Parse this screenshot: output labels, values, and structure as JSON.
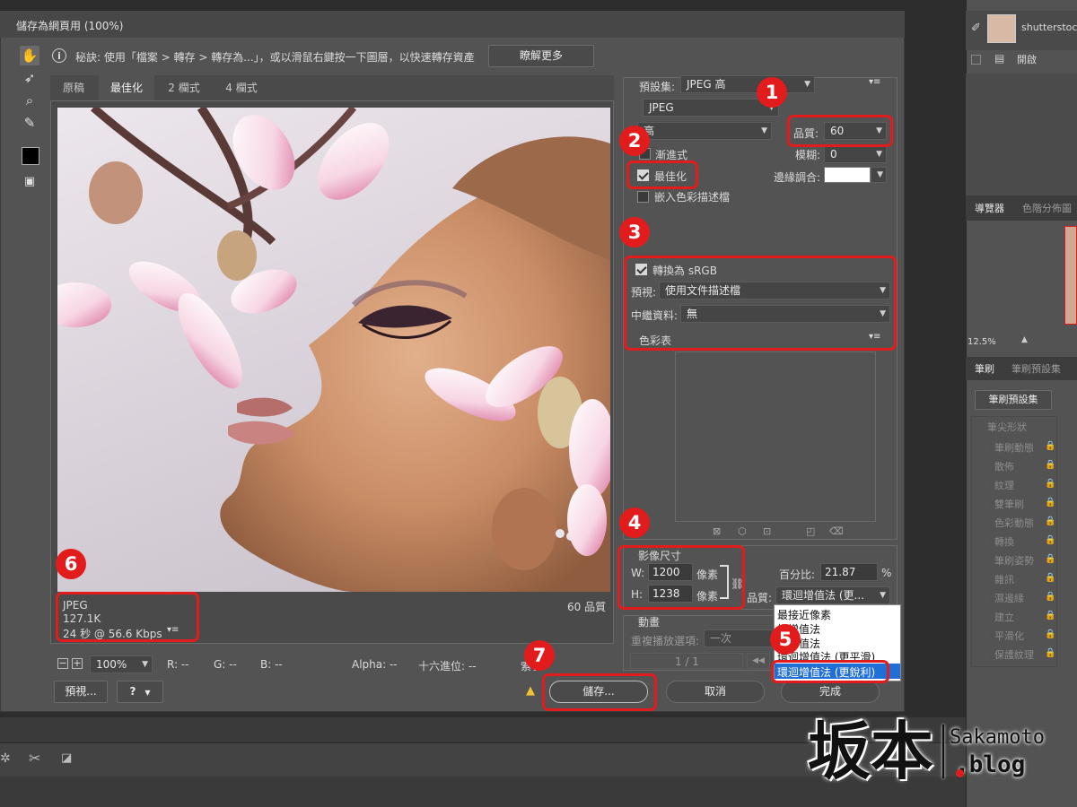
{
  "dialog": {
    "title": "儲存為網頁用 (100%)",
    "tip": "秘訣: 使用「檔案 > 轉存 > 轉存為...」，或以滑鼠右鍵按一下圖層，以快速轉存資產",
    "learn_more": "瞭解更多",
    "tabs": [
      "原稿",
      "最佳化",
      "2 欄式",
      "4 欄式"
    ],
    "active_tab": "最佳化"
  },
  "image_info": {
    "format": "JPEG",
    "size": "127.1K",
    "time": "24 秒 @ 56.6 Kbps",
    "quality_label": "60 品質"
  },
  "bottom_bar": {
    "zoom": "100%",
    "r": "R: --",
    "g": "G: --",
    "b": "B: --",
    "alpha": "Alpha: --",
    "hex": "十六進位: --",
    "index": "索引: --",
    "preview_btn": "預視...",
    "save_btn": "儲存...",
    "cancel_btn": "取消",
    "done_btn": "完成"
  },
  "settings": {
    "preset_label": "預設集:",
    "preset": "JPEG 高",
    "format": "JPEG",
    "compression": "高",
    "quality_label": "品質:",
    "quality": "60",
    "progressive": "漸進式",
    "blur_label": "模糊:",
    "blur": "0",
    "optimized": "最佳化",
    "matte_label": "邊緣調合:",
    "embed_profile": "嵌入色彩描述檔",
    "convert_srgb": "轉換為 sRGB",
    "preview_label": "預視:",
    "preview_value": "使用文件描述檔",
    "metadata_label": "中繼資料:",
    "metadata_value": "無",
    "color_table": "色彩表"
  },
  "image_size": {
    "title": "影像尺寸",
    "w_label": "W:",
    "w": "1200",
    "h_label": "H:",
    "h": "1238",
    "unit": "像素",
    "percent_label": "百分比:",
    "percent": "21.87",
    "percent_unit": "%",
    "quality_label": "品質:",
    "quality_value": "環迴增值法 (更...",
    "options": [
      "最接近像素",
      "縱增值法",
      "縱增值法",
      "環迴增值法 (更平滑)",
      "環迴增值法 (更銳利)"
    ],
    "selected_option": "環迴增值法 (更銳利)"
  },
  "animation": {
    "title": "動畫",
    "loop_label": "重複播放選項:",
    "loop_value": "一次",
    "frame": "1 / 1"
  },
  "badges": [
    "1",
    "2",
    "3",
    "4",
    "5",
    "6",
    "7"
  ],
  "right_panel": {
    "layer_name": "shutterstock",
    "layer_item": "開啟",
    "tabs1": [
      "導覽器",
      "色階分佈圖"
    ],
    "zoom": "12.5%",
    "tabs2": [
      "筆刷",
      "筆刷預設集"
    ],
    "brush_presets_btn": "筆刷預設集",
    "brush_items": [
      "筆尖形狀",
      "筆刷動態",
      "散佈",
      "紋理",
      "雙筆刷",
      "色彩動態",
      "轉換",
      "筆刷姿勢",
      "雜訊",
      "濕邊緣",
      "建立",
      "平滑化",
      "保護紋理"
    ]
  },
  "watermark": {
    "kanji": "坂本",
    "latin": "Sakamoto",
    "suffix": ".blog"
  },
  "colors": {
    "badge_red": "#e21c1c",
    "selection_blue": "#1f6fd6",
    "dialog_bg": "#535353"
  }
}
